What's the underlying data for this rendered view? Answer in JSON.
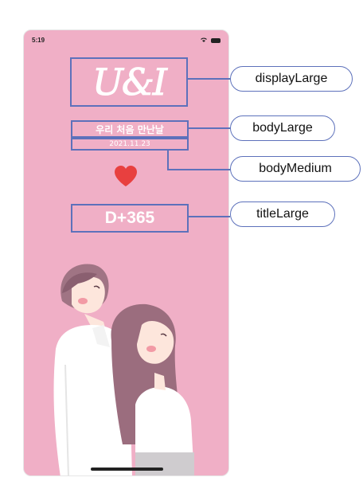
{
  "status_bar": {
    "time": "5:19"
  },
  "screen": {
    "display_text": "U&I",
    "body_large_text": "우리 처음 만난날",
    "body_medium_text": "2021.11.23",
    "title_text": "D+365"
  },
  "callouts": [
    {
      "label": "displayLarge"
    },
    {
      "label": "bodyLarge"
    },
    {
      "label": "bodyMedium"
    },
    {
      "label": "titleLarge"
    }
  ],
  "colors": {
    "background": "#f0afc6",
    "highlight_border": "#5d71bb",
    "heart": "#e8403f",
    "text": "#ffffff"
  }
}
